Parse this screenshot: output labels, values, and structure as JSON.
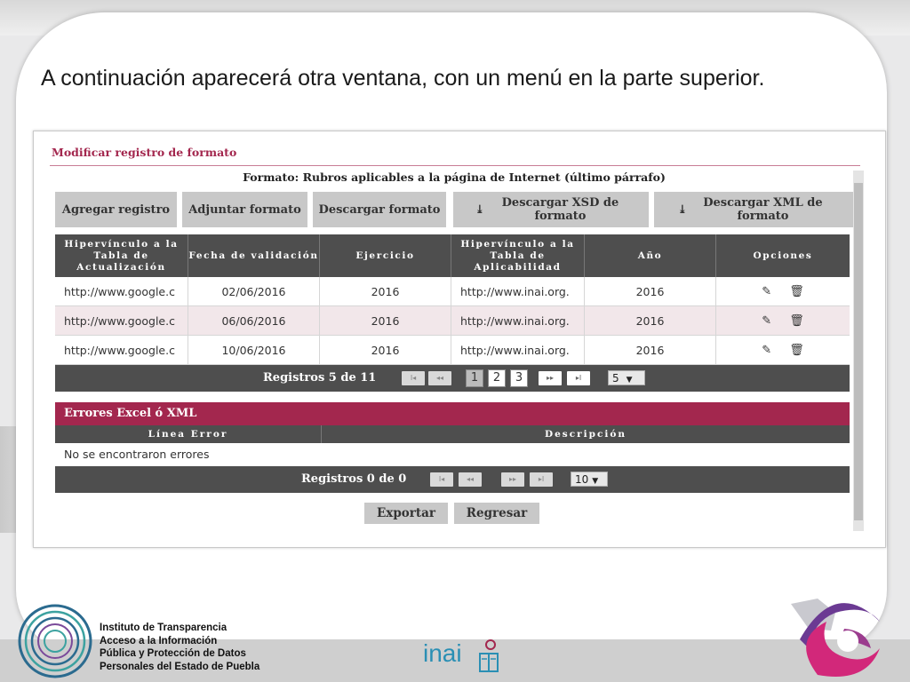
{
  "caption": "A continuación aparecerá otra ventana, con un menú en la parte superior.",
  "screenshot": {
    "title": "Modificar registro de formato",
    "format_title": "Formato: Rubros aplicables a la página de Internet (último párrafo)",
    "toolbar": {
      "add_label": "Agregar registro",
      "attach_label": "Adjuntar formato",
      "download_label": "Descargar formato",
      "download_xsd_label": "Descargar XSD de formato",
      "download_xml_label": "Descargar XML de formato"
    },
    "table": {
      "columns": [
        "Hipervínculo a la Tabla de Actualización",
        "Fecha de validación",
        "Ejercicio",
        "Hipervínculo a la Tabla de Aplicabilidad",
        "Año",
        "Opciones"
      ],
      "rows": [
        [
          "http://www.google.c",
          "02/06/2016",
          "2016",
          "http://www.inai.org.",
          "2016"
        ],
        [
          "http://www.google.c",
          "06/06/2016",
          "2016",
          "http://www.inai.org.",
          "2016"
        ],
        [
          "http://www.google.c",
          "10/06/2016",
          "2016",
          "http://www.inai.org.",
          "2016"
        ]
      ],
      "edit_icon": "pencil-icon",
      "delete_icon": "trash-icon"
    },
    "pager": {
      "label": "Registros 5 de 11",
      "pages": [
        "1",
        "2",
        "3"
      ],
      "current_page": "1",
      "page_size": "5"
    },
    "errors": {
      "title": "Errores Excel ó XML",
      "columns": [
        "Línea Error",
        "Descripción"
      ],
      "empty_message": "No se encontraron errores",
      "pager_label": "Registros 0 de 0",
      "page_size": "10"
    },
    "actions": {
      "export_label": "Exportar",
      "back_label": "Regresar"
    }
  },
  "footer": {
    "institute_lines": [
      "Instituto de Transparencia",
      "Acceso a la Información",
      "Pública y Protección de Datos",
      "Personales del Estado de Puebla"
    ],
    "inai_logo_text": "inai"
  },
  "colors": {
    "accent": "#a3274e",
    "header_dark": "#4e4e4e",
    "button_gray": "#c8c8c8",
    "inai_blue": "#2a8fb4"
  }
}
